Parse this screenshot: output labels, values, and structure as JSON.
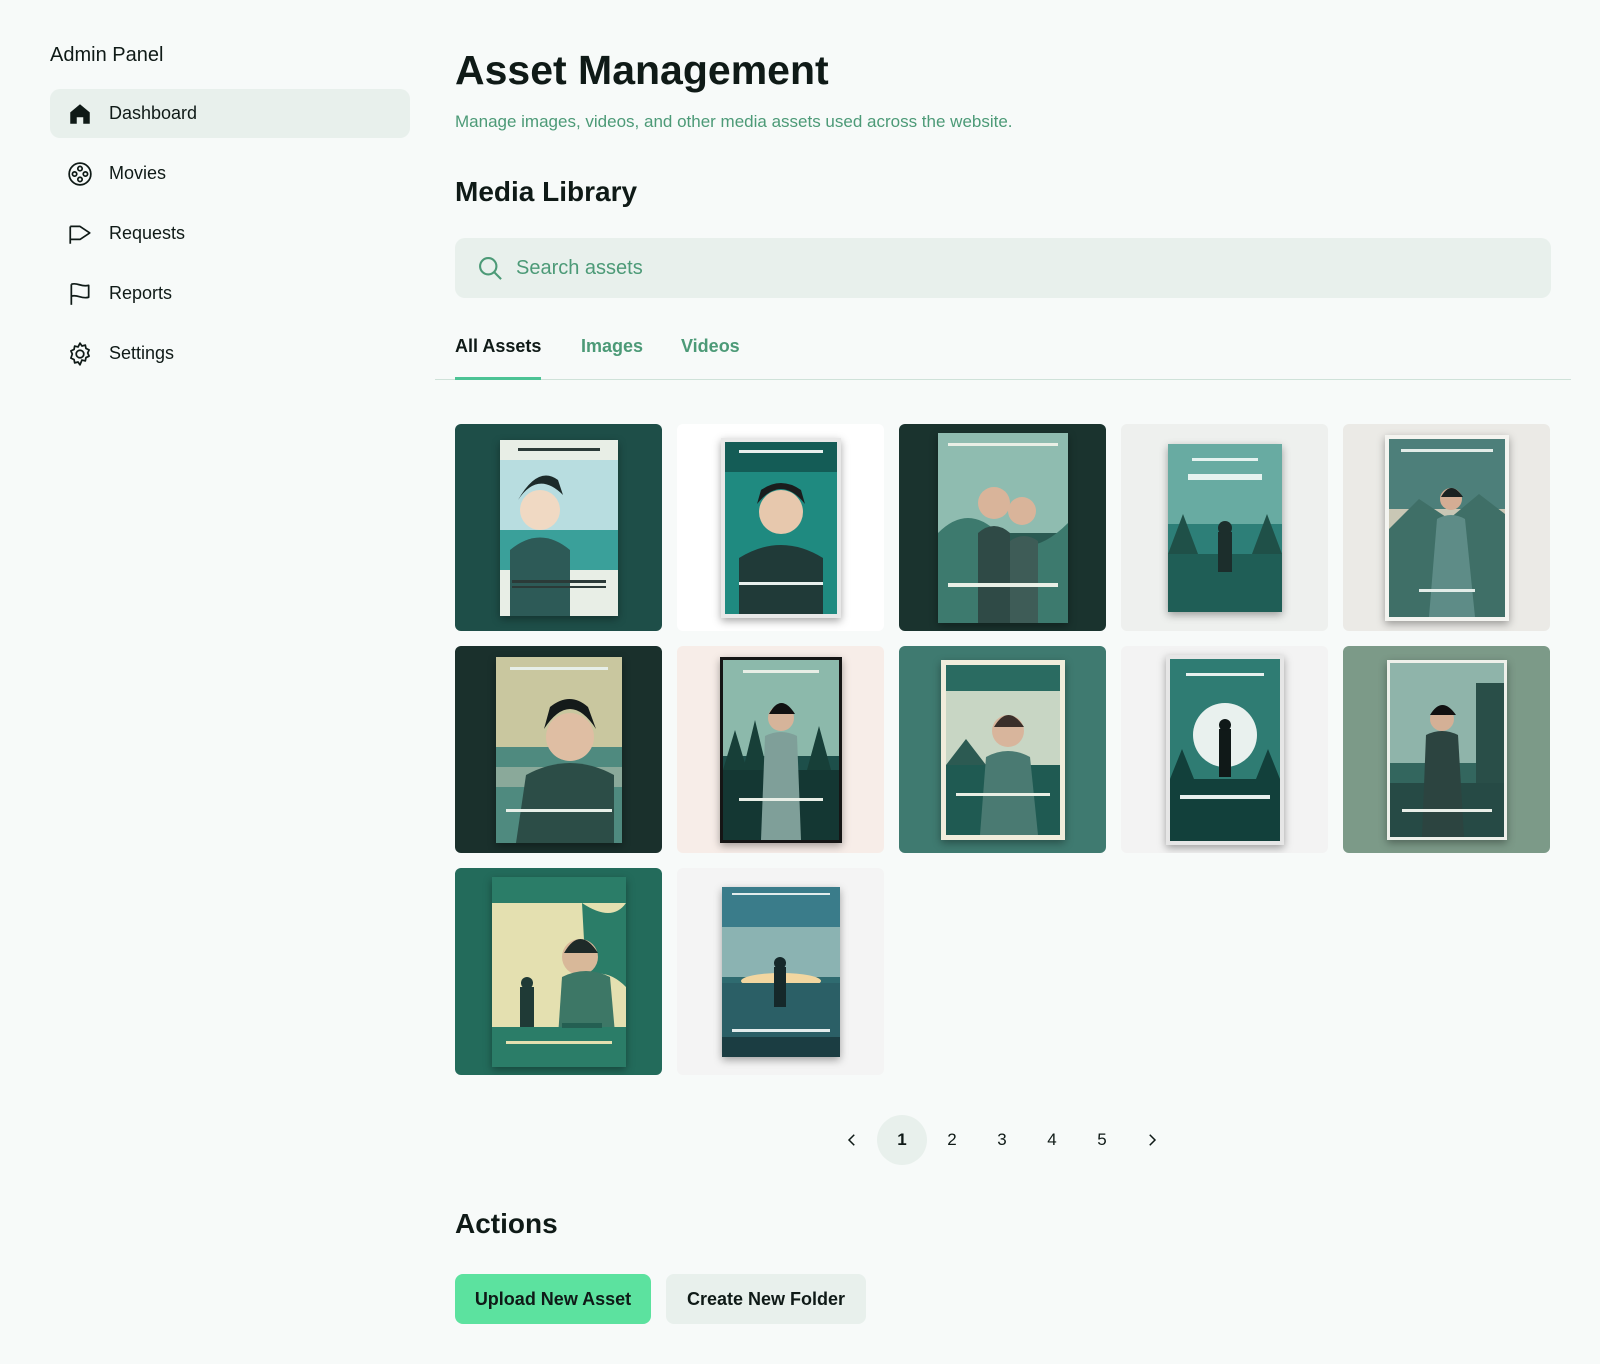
{
  "sidebar": {
    "brand": "Admin Panel",
    "items": [
      {
        "label": "Dashboard",
        "icon": "home-icon",
        "active": true
      },
      {
        "label": "Movies",
        "icon": "film-reel-icon",
        "active": false
      },
      {
        "label": "Requests",
        "icon": "megaphone-icon",
        "active": false
      },
      {
        "label": "Reports",
        "icon": "flag-icon",
        "active": false
      },
      {
        "label": "Settings",
        "icon": "gear-icon",
        "active": false
      }
    ]
  },
  "header": {
    "title": "Asset Management",
    "subtitle": "Manage images, videos, and other media assets used across the website."
  },
  "library": {
    "title": "Media Library",
    "search_placeholder": "Search assets",
    "tabs": [
      {
        "label": "All Assets",
        "active": true
      },
      {
        "label": "Images",
        "active": false
      },
      {
        "label": "Videos",
        "active": false
      }
    ]
  },
  "assets": [
    {
      "name": "poster-1",
      "bg": "#1e4e48"
    },
    {
      "name": "poster-2",
      "bg": "#ffffff"
    },
    {
      "name": "poster-3",
      "bg": "#1a332e"
    },
    {
      "name": "poster-4",
      "bg": "#eef0ee"
    },
    {
      "name": "poster-5",
      "bg": "#ebeae6"
    },
    {
      "name": "poster-6",
      "bg": "#1a302c"
    },
    {
      "name": "poster-7",
      "bg": "#f7ede8"
    },
    {
      "name": "poster-8",
      "bg": "#3f7a70"
    },
    {
      "name": "poster-9",
      "bg": "#f3f3f3"
    },
    {
      "name": "poster-10",
      "bg": "#7c9a88"
    },
    {
      "name": "poster-11",
      "bg": "#236b5b"
    },
    {
      "name": "poster-12",
      "bg": "#f4f4f4"
    }
  ],
  "pagination": {
    "pages": [
      "1",
      "2",
      "3",
      "4",
      "5"
    ],
    "current": "1"
  },
  "actions": {
    "title": "Actions",
    "upload_label": "Upload New Asset",
    "folder_label": "Create New Folder"
  },
  "colors": {
    "accent": "#4c9a77",
    "primary_button": "#5ce29f",
    "surface": "#e8f0ec"
  }
}
